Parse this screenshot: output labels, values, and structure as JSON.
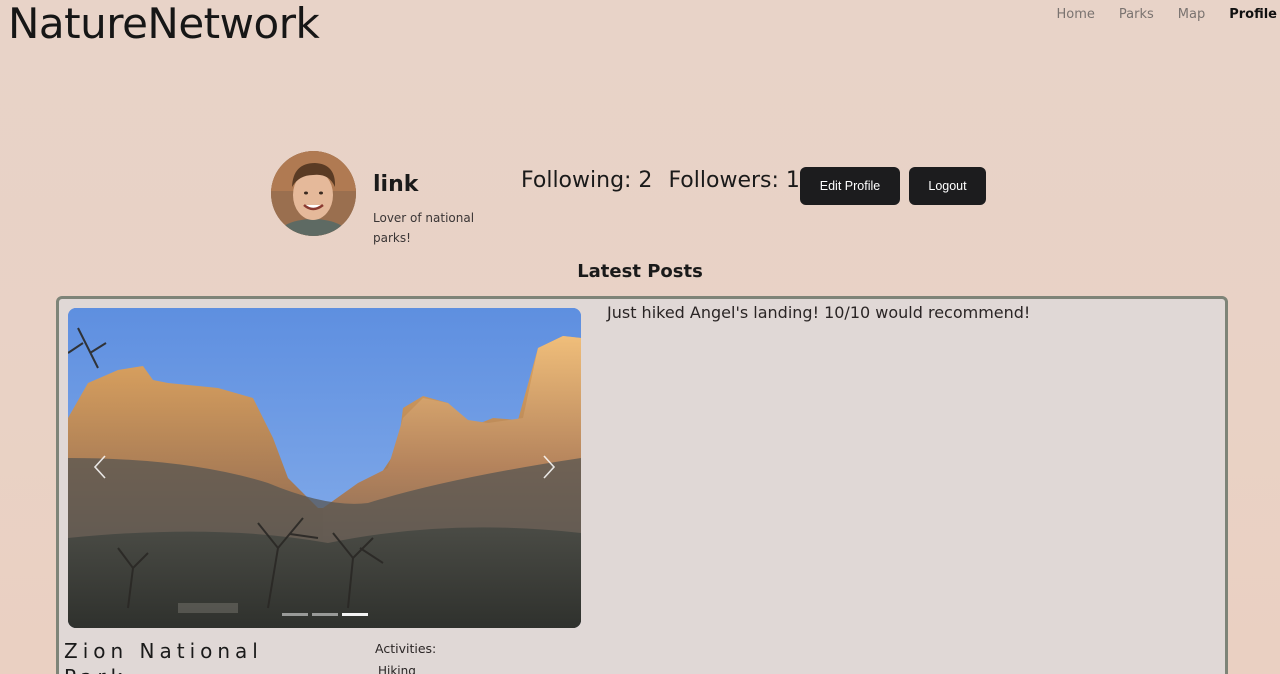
{
  "brand": "NatureNetwork",
  "nav": {
    "items": [
      {
        "label": "Home"
      },
      {
        "label": "Parks"
      },
      {
        "label": "Map"
      },
      {
        "label": "Profile"
      }
    ],
    "active": "Profile"
  },
  "profile": {
    "username": "link",
    "bio": "Lover of national parks!",
    "following": "Following: 2",
    "followers": "Followers: 1",
    "edit_label": "Edit Profile",
    "logout_label": "Logout"
  },
  "posts_section": {
    "title": "Latest Posts"
  },
  "post": {
    "text": "Just hiked Angel's landing! 10/10 would recommend!",
    "park": "Zion National Park",
    "activities_label": "Activities:",
    "activities": [
      "Hiking"
    ],
    "carousel": {
      "slides": 3,
      "active_index": 2
    }
  },
  "colors": {
    "background": "#e8d3c8",
    "button": "#1c1c1e",
    "card_border": "#7e8478",
    "card_bg": "#e0d8d6"
  }
}
